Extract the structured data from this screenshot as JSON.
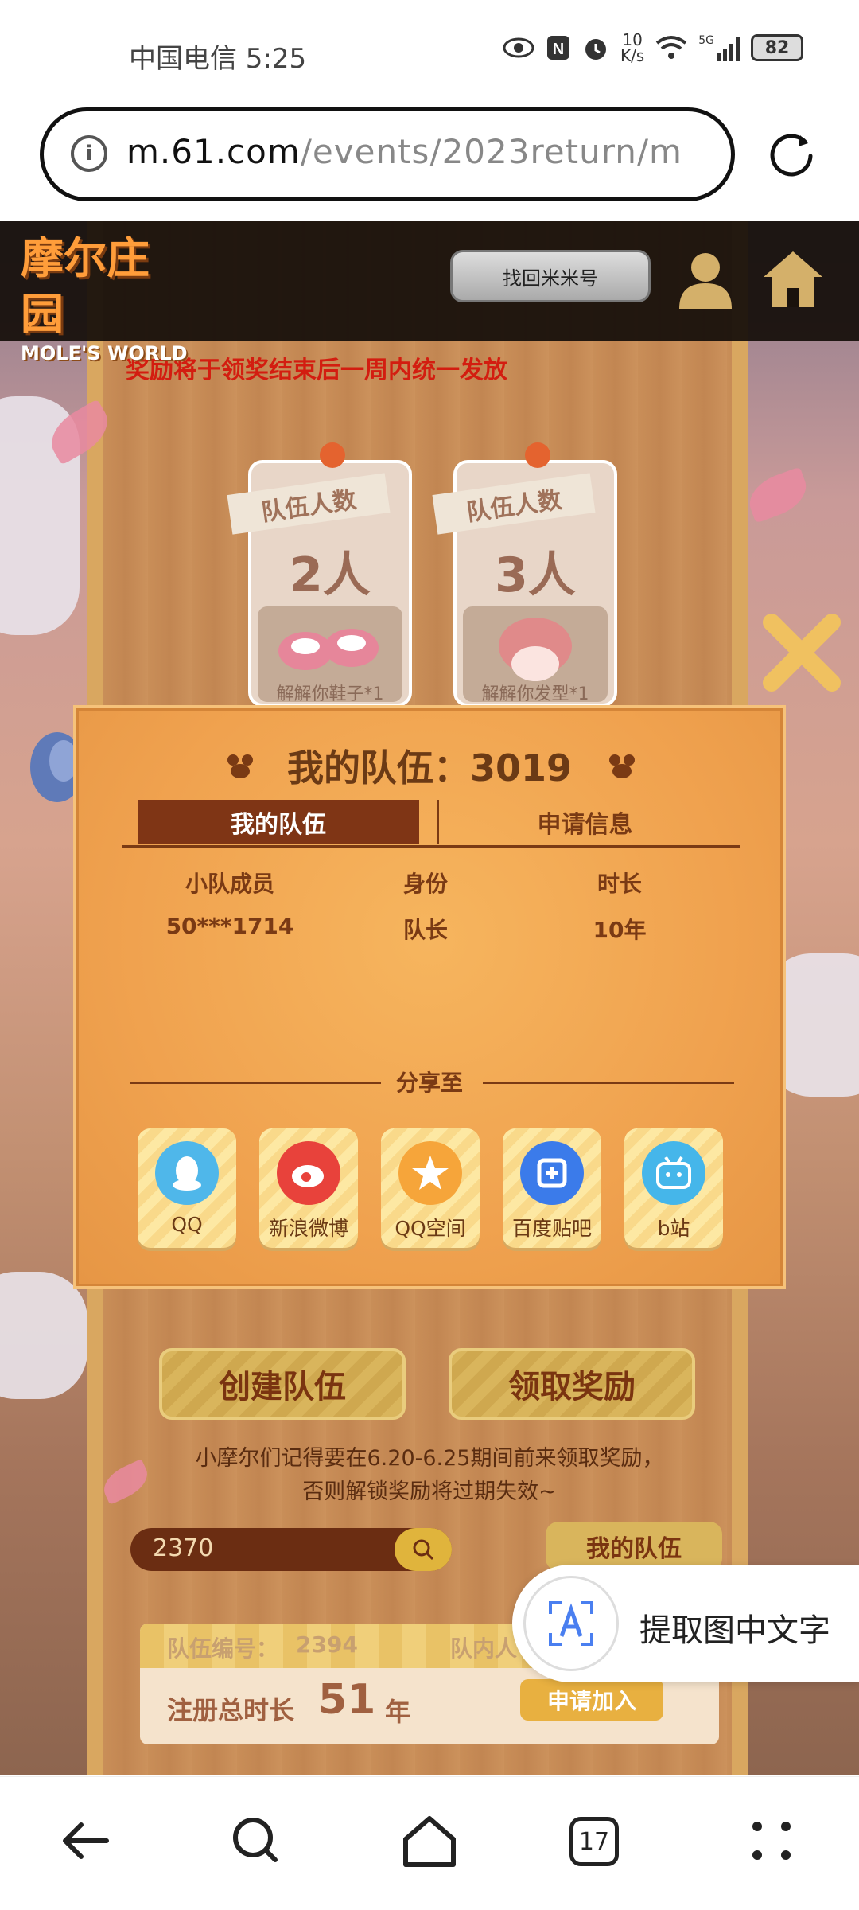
{
  "status_bar": {
    "carrier": "中国电信 5:25",
    "net_speed_value": "10",
    "net_speed_unit": "K/s",
    "signal_label": "5G",
    "battery": "82"
  },
  "address_bar": {
    "domain": "m.61.com",
    "path": "/events/2023return/m"
  },
  "header": {
    "logo_cn": "摩尔庄园",
    "logo_en": "MOLE'S WORLD",
    "retrieve_button": "找回米米号"
  },
  "page": {
    "reward_notice": "奖励将于领奖结束后一周内统一发放",
    "team_cards": [
      {
        "banner": "队伍人数",
        "count": "2人",
        "caption": "解解你鞋子*1"
      },
      {
        "banner": "队伍人数",
        "count": "3人",
        "caption": "解解你发型*1"
      }
    ]
  },
  "dialog": {
    "title": "我的队伍：3019",
    "tabs": [
      "我的队伍",
      "申请信息"
    ],
    "columns": [
      "小队成员",
      "身份",
      "时长"
    ],
    "rows": [
      [
        "50***1714",
        "队长",
        "10年"
      ]
    ],
    "share_label": "分享至",
    "share_targets": [
      {
        "label": "QQ",
        "icon": "qq-icon",
        "color": "#4fb7ea"
      },
      {
        "label": "新浪微博",
        "icon": "weibo-icon",
        "color": "#e8423b"
      },
      {
        "label": "QQ空间",
        "icon": "qzone-icon",
        "color": "#f6a53a"
      },
      {
        "label": "百度贴吧",
        "icon": "tieba-icon",
        "color": "#3b7bea"
      },
      {
        "label": "b站",
        "icon": "bilibili-icon",
        "color": "#45b6ea"
      }
    ]
  },
  "actions": {
    "create_team": "创建队伍",
    "claim_reward": "领取奖励"
  },
  "note": {
    "line1": "小摩尔们记得要在6.20-6.25期间前来领取奖励，",
    "line2": "否则解锁奖励将过期失效~"
  },
  "search": {
    "value": "2370",
    "my_team_button": "我的队伍"
  },
  "team_listing": {
    "team_no_label": "队伍编号：",
    "team_no": "2394",
    "members_label": "队内人",
    "duration_label": "注册总时长",
    "duration_value": "51",
    "duration_unit": "年",
    "apply_button": "申请加入"
  },
  "ocr_popup": {
    "label": "提取图中文字"
  },
  "browser_nav": {
    "tab_count": "17"
  }
}
